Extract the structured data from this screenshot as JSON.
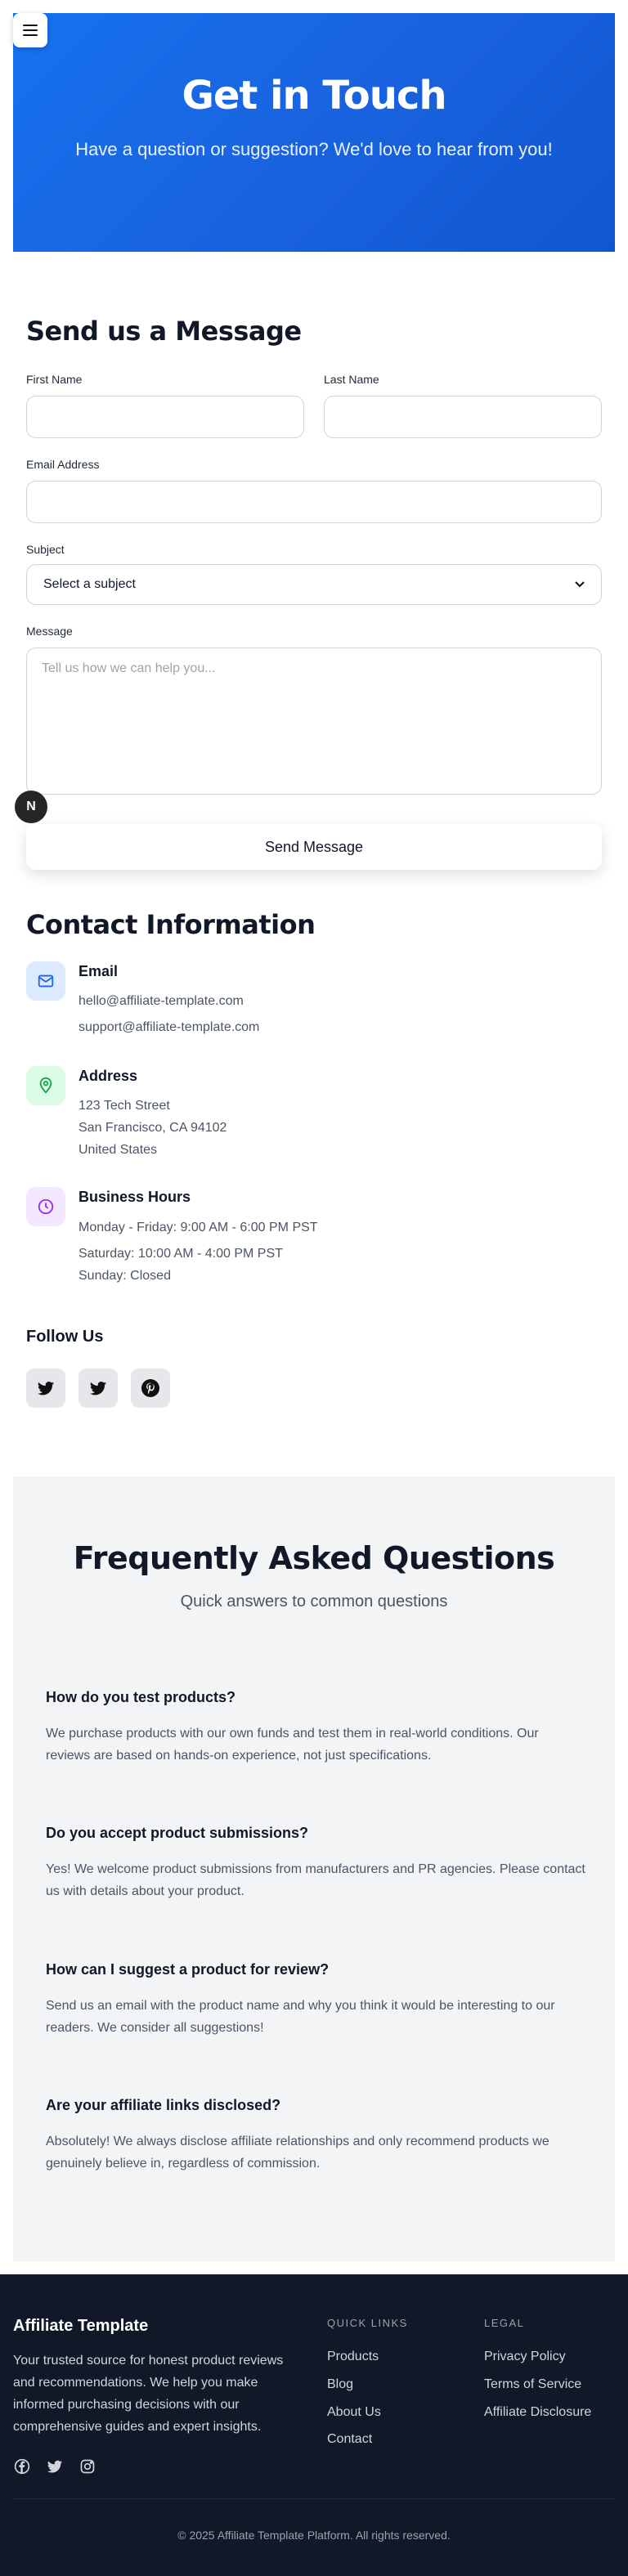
{
  "hero": {
    "title": "Get in Touch",
    "subtitle": "Have a question or suggestion? We'd love to hear from you!"
  },
  "form": {
    "title": "Send us a Message",
    "first_name_label": "First Name",
    "last_name_label": "Last Name",
    "email_label": "Email Address",
    "subject_label": "Subject",
    "subject_selected": "Select a subject",
    "message_label": "Message",
    "message_placeholder": "Tell us how we can help you...",
    "submit_label": "Send Message",
    "badge": "N"
  },
  "contact": {
    "title": "Contact Information",
    "email": {
      "heading": "Email",
      "lines": [
        "hello@affiliate-template.com",
        "support@affiliate-template.com"
      ],
      "color": "#2563eb",
      "bg": "#dbeafe",
      "icon": "mail-icon"
    },
    "address": {
      "heading": "Address",
      "lines": [
        "123 Tech Street",
        "San Francisco, CA 94102",
        "United States"
      ],
      "color": "#16a34a",
      "bg": "#dcfce7",
      "icon": "map-pin-icon"
    },
    "hours": {
      "heading": "Business Hours",
      "lines": [
        "Monday - Friday: 9:00 AM - 6:00 PM PST",
        "Saturday: 10:00 AM - 4:00 PM PST",
        "Sunday: Closed"
      ],
      "color": "#9333ea",
      "bg": "#f3e8ff",
      "icon": "clock-icon"
    }
  },
  "follow": {
    "title": "Follow Us",
    "icons": [
      "twitter-icon",
      "twitter-icon",
      "pinterest-icon"
    ]
  },
  "faq": {
    "title": "Frequently Asked Questions",
    "subtitle": "Quick answers to common questions",
    "items": [
      {
        "q": "How do you test products?",
        "a": "We purchase products with our own funds and test them in real-world conditions. Our reviews are based on hands-on experience, not just specifications."
      },
      {
        "q": "Do you accept product submissions?",
        "a": "Yes! We welcome product submissions from manufacturers and PR agencies. Please contact us with details about your product."
      },
      {
        "q": "How can I suggest a product for review?",
        "a": "Send us an email with the product name and why you think it would be interesting to our readers. We consider all suggestions!"
      },
      {
        "q": "Are your affiliate links disclosed?",
        "a": "Absolutely! We always disclose affiliate relationships and only recommend products we genuinely believe in, regardless of commission."
      }
    ]
  },
  "footer": {
    "brand": "Affiliate Template",
    "description": "Your trusted source for honest product reviews and recommendations. We help you make informed purchasing decisions with our comprehensive guides and expert insights.",
    "social_icons": [
      "facebook-icon",
      "twitter-icon",
      "instagram-icon"
    ],
    "quick_links_heading": "QUICK LINKS",
    "quick_links": [
      "Products",
      "Blog",
      "About Us",
      "Contact"
    ],
    "legal_heading": "LEGAL",
    "legal_links": [
      "Privacy Policy",
      "Terms of Service",
      "Affiliate Disclosure"
    ],
    "copyright": "© 2025 Affiliate Template Platform. All rights reserved."
  }
}
